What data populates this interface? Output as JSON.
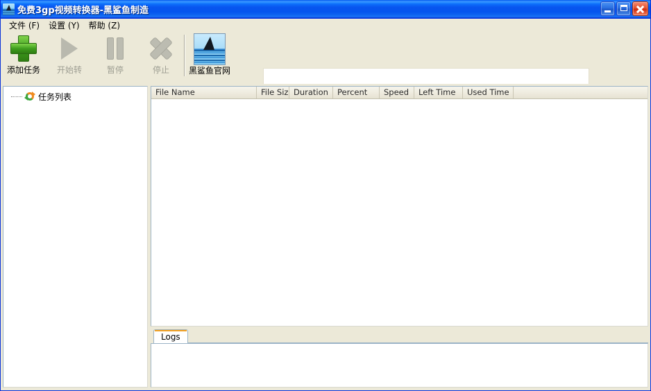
{
  "window": {
    "title": "免费3gp视频转换器-黑鲨鱼制造",
    "icon": "shark-icon",
    "controls": {
      "minimize": "minimize-button",
      "maximize": "maximize-button",
      "close": "close-button"
    }
  },
  "menubar": {
    "items": [
      {
        "label": "文件 (F)"
      },
      {
        "label": "设置 (Y)"
      },
      {
        "label": "帮助 (Z)"
      }
    ]
  },
  "toolbar": {
    "buttons": [
      {
        "label": "添加任务",
        "icon": "plus-icon",
        "enabled": true
      },
      {
        "label": "开始转",
        "icon": "play-icon",
        "enabled": false
      },
      {
        "label": "暂停",
        "icon": "pause-icon",
        "enabled": false
      },
      {
        "label": "停止",
        "icon": "stop-icon",
        "enabled": false
      }
    ],
    "website_button": {
      "label": "黑鲨鱼官网",
      "icon": "shark-logo-icon"
    }
  },
  "sidebar": {
    "nodes": [
      {
        "label": "任务列表",
        "icon": "convert-arrows-icon"
      }
    ]
  },
  "task_list": {
    "columns": [
      {
        "label": "File Name",
        "width": 152
      },
      {
        "label": "File Size",
        "width": 47
      },
      {
        "label": "Duration",
        "width": 63
      },
      {
        "label": "Percent",
        "width": 67
      },
      {
        "label": "Speed",
        "width": 50
      },
      {
        "label": "Left Time",
        "width": 70
      },
      {
        "label": "Used Time",
        "width": 73
      },
      {
        "label": "",
        "width": 180
      }
    ],
    "rows": []
  },
  "bottom_tabs": {
    "tabs": [
      {
        "label": "Logs",
        "active": true
      }
    ],
    "log_text": ""
  },
  "colors": {
    "title_bar": "#0855ef",
    "face": "#ece9d8",
    "tab_accent": "#f4a01e",
    "plus_green": "#3f9e1e",
    "disabled_gray": "#bcbcb1"
  }
}
